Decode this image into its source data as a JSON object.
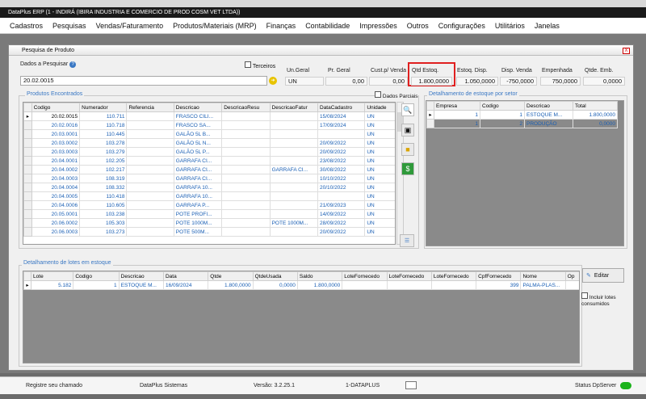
{
  "app_title": "DataPlus ERP (1 - INDIRÁ  (IBIRA INDUSTRIA E COMERCIO DE PROD COSM VET LTDA))",
  "menu": [
    "Cadastros",
    "Pesquisas",
    "Vendas/Faturamento",
    "Produtos/Materiais (MRP)",
    "Finanças",
    "Contabilidade",
    "Impressões",
    "Outros",
    "Configurações",
    "Utilitários",
    "Janelas"
  ],
  "window": {
    "title": "Pesquisa de Produto",
    "close": "X"
  },
  "search": {
    "label": "Dados a Pesquisar",
    "value": "20.02.0015",
    "terceiros_label": "Terceiros",
    "help": "?",
    "go": "➜"
  },
  "summary": {
    "un_geral": {
      "label": "Un.Geral",
      "value": "UN"
    },
    "pr_geral": {
      "label": "Pr. Geral",
      "value": "0,00"
    },
    "cust_venda": {
      "label": "Cust.p/ Venda",
      "value": "0,00"
    },
    "qtd_estoq": {
      "label": "Qtd Estoq.",
      "value": "1.800,0000"
    },
    "estoq_disp": {
      "label": "Estoq. Disp.",
      "value": "1.050,0000"
    },
    "disp_venda": {
      "label": "Disp. Venda",
      "value": "-750,0000"
    },
    "empenhada": {
      "label": "Empenhada",
      "value": "750,0000"
    },
    "qtde_emb": {
      "label": "Qtde. Emb.",
      "value": "0,0000"
    }
  },
  "produtos": {
    "title": "Produtos Encontrados",
    "dados_parciais": "Dados Parciais",
    "columns": [
      "Codigo",
      "Numerador",
      "Referencia",
      "Descricao",
      "DescricaoResu",
      "DescricaoFatur",
      "DataCadastro",
      "Unidade"
    ],
    "rows": [
      [
        "20.02.0015",
        "110.711",
        "",
        "FRASCO CILI...",
        "",
        "",
        "15/08/2024",
        "UN"
      ],
      [
        "20.02.0016",
        "110.718",
        "",
        "FRASCO SA...",
        "",
        "",
        "17/09/2024",
        "UN"
      ],
      [
        "20.03.0001",
        "110.445",
        "",
        "GALÃO 5L B...",
        "",
        "",
        "",
        "UN"
      ],
      [
        "20.03.0002",
        "103.278",
        "",
        "GALÃO 5L N...",
        "",
        "",
        "20/09/2022",
        "UN"
      ],
      [
        "20.03.0003",
        "103.279",
        "",
        "GALÃO 5L P...",
        "",
        "",
        "20/09/2022",
        "UN"
      ],
      [
        "20.04.0001",
        "102.205",
        "",
        "GARRAFA CI...",
        "",
        "",
        "23/08/2022",
        "UN"
      ],
      [
        "20.04.0002",
        "102.217",
        "",
        "GARRAFA CI...",
        "",
        "GARRAFA CI...",
        "30/08/2022",
        "UN"
      ],
      [
        "20.04.0003",
        "108.319",
        "",
        "GARRAFA CI...",
        "",
        "",
        "10/10/2022",
        "UN"
      ],
      [
        "20.04.0004",
        "108.332",
        "",
        "GARRAFA 10...",
        "",
        "",
        "20/10/2022",
        "UN"
      ],
      [
        "20.04.0005",
        "110.418",
        "",
        "GARRAFA 10...",
        "",
        "",
        "",
        "UN"
      ],
      [
        "20.04.0006",
        "110.605",
        "",
        "GARRAFA P...",
        "",
        "",
        "21/09/2023",
        "UN"
      ],
      [
        "20.05.0001",
        "103.238",
        "",
        "POTE PROFI...",
        "",
        "",
        "14/09/2022",
        "UN"
      ],
      [
        "20.06.0002",
        "105.303",
        "",
        "POTE 1000M...",
        "",
        "POTE 1000M...",
        "28/09/2022",
        "UN"
      ],
      [
        "20.06.0003",
        "103.273",
        "",
        "POTE 500M...",
        "",
        "",
        "20/09/2022",
        "UN"
      ]
    ]
  },
  "setor": {
    "title": "Detalhamento de estoque por setor",
    "columns": [
      "Empresa",
      "Codigo",
      "Descricao",
      "Total"
    ],
    "rows": [
      [
        "1",
        "1",
        "ESTOQUE M...",
        "1.800,0000"
      ],
      [
        "1",
        "2",
        "PRODUÇÃO",
        "0,0000"
      ]
    ]
  },
  "lotes": {
    "title": "Detalhamento de lotes em estoque",
    "columns": [
      "Lote",
      "Codigo",
      "Descricao",
      "Data",
      "Qtde",
      "QtdeUsada",
      "Saldo",
      "LoteFornecedo",
      "LoteFornecedo",
      "LoteFornecedo",
      "CpfFornecedo",
      "Nome",
      "Op"
    ],
    "rows": [
      [
        "5.182",
        "1",
        "ESTOQUE M...",
        "16/09/2024",
        "1.800,0000",
        "0,0000",
        "1.800,0000",
        "",
        "",
        "",
        "399",
        "PALMA-PLAS...",
        ""
      ]
    ],
    "editar": "Editar",
    "incluir": "Incluir lotes consumidos"
  },
  "statusbar": {
    "chamado": "Registre seu chamado",
    "empresa": "DataPlus Sistemas",
    "versao": "Versão: 3.2.25.1",
    "usuario": "1-DATAPLUS",
    "dpserver": "Status DpServer"
  },
  "colors": {
    "accent": "#3a78c4",
    "highlight": "#e02020",
    "status_ok": "#1bb31b"
  }
}
